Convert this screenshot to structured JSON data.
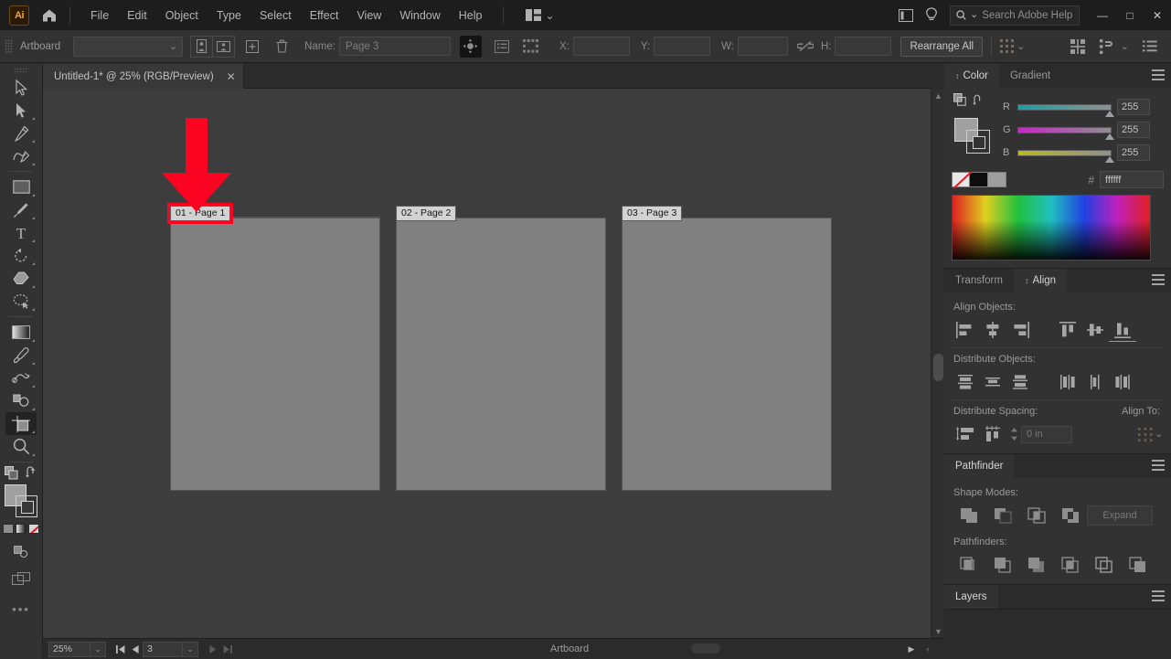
{
  "app": {
    "name": "Adobe Illustrator",
    "logo_text": "Ai",
    "logo_color": "#f2a33c"
  },
  "menubar": {
    "home_icon": "home-icon",
    "items": [
      "File",
      "Edit",
      "Object",
      "Type",
      "Select",
      "Effect",
      "View",
      "Window",
      "Help"
    ],
    "workspace_icon": "workspace-switcher-icon",
    "workspace_chevron": "⌄",
    "arrange_icon": "arrange-documents-icon",
    "help_bulb_icon": "lightbulb-icon",
    "search": {
      "placeholder": "Search Adobe Help",
      "icon": "search-icon",
      "chevron": "⌄"
    },
    "window_controls": {
      "minimize": "—",
      "maximize": "□",
      "close": "✕"
    }
  },
  "controlbar": {
    "context_label": "Artboard",
    "preset_select_chevron": "⌄",
    "portrait_icon": "artboard-portrait-icon",
    "landscape_icon": "artboard-landscape-icon",
    "new_artboard_icon": "new-artboard-icon",
    "delete_artboard_icon": "trash-icon",
    "name_label": "Name:",
    "name_value": "Page 3",
    "move_artwork_icon": "move-artwork-with-artboard-icon",
    "artboard_options_icon": "artboard-options-icon",
    "artboard_presets_icon": "artboard-presets-grid-icon",
    "x_label": "X:",
    "x_value": "",
    "y_label": "Y:",
    "y_value": "",
    "w_label": "W:",
    "w_value": "",
    "h_label": "H:",
    "h_value": "",
    "link_icon": "unlink-proportions-icon",
    "rearrange_label": "Rearrange All",
    "reference_point_icon": "reference-point-icon",
    "align_icon": "align-icon",
    "transform_icon": "transform-icon",
    "options_icon": "document-setup-list-icon"
  },
  "document": {
    "tab_title": "Untitled-1* @ 25% (RGB/Preview)",
    "close_icon": "✕",
    "overflow_chevron": "»"
  },
  "toolbar": {
    "tools": [
      {
        "name": "selection-tool",
        "active": false
      },
      {
        "name": "direct-selection-tool",
        "active": false
      },
      {
        "name": "pen-tool",
        "active": false
      },
      {
        "name": "curvature-tool",
        "active": false
      },
      {
        "name": "rectangle-tool",
        "active": false
      },
      {
        "name": "paintbrush-tool",
        "active": false
      },
      {
        "name": "type-tool",
        "active": false
      },
      {
        "name": "rotate-tool",
        "active": false
      },
      {
        "name": "eraser-tool",
        "active": false
      },
      {
        "name": "lasso-tool",
        "active": false
      },
      {
        "name": "gradient-tool",
        "active": false
      },
      {
        "name": "eyedropper-tool",
        "active": false
      },
      {
        "name": "blend-tool",
        "active": false
      },
      {
        "name": "shape-builder-tool",
        "active": false
      },
      {
        "name": "artboard-tool",
        "active": true
      },
      {
        "name": "zoom-tool",
        "active": false
      }
    ],
    "more_tools_icon": "•••"
  },
  "canvas": {
    "background": "#3d3d3d",
    "artboard_fill": "#808080",
    "artboards": [
      {
        "label": "01 - Page 1",
        "highlighted": true
      },
      {
        "label": "02 - Page 2",
        "highlighted": false
      },
      {
        "label": "03 - Page 3",
        "highlighted": false
      }
    ],
    "annotation": {
      "type": "red-arrow",
      "color": "#fb0422",
      "direction": "down",
      "points_to": "01 - Page 1"
    }
  },
  "statusbar": {
    "zoom_value": "25%",
    "zoom_chevron": "⌄",
    "first_icon": "◀|",
    "prev_icon": "◀",
    "artboard_number": "3",
    "number_chevron": "⌄",
    "next_icon": "▶",
    "last_icon": "|▶",
    "status_text": "Artboard",
    "status_play_icon": "▶",
    "status_left_icon": "‹"
  },
  "panels": {
    "color": {
      "tabs": [
        {
          "label": "Color",
          "active": true
        },
        {
          "label": "Gradient",
          "active": false
        }
      ],
      "menu_icon": "panel-menu-icon",
      "swap_icon": "swap-fill-stroke-icon",
      "fill_stroke_icon": "fill-stroke-proxy-icon",
      "sliders": [
        {
          "channel": "R",
          "value": "255",
          "gradient_from": "#18a0a8",
          "gradient_to": "#8f8f8f"
        },
        {
          "channel": "G",
          "value": "255",
          "gradient_from": "#c329c3",
          "gradient_to": "#8f8f8f"
        },
        {
          "channel": "B",
          "value": "255",
          "gradient_from": "#b8b81e",
          "gradient_to": "#8f8f8f"
        }
      ],
      "none_swatch": "none-swatch",
      "black_swatch": "#0d0d0d",
      "gray_swatch": "#9e9e9e",
      "hex_label": "#",
      "hex_value": "ffffff"
    },
    "align": {
      "tabs": [
        {
          "label": "Transform",
          "active": false
        },
        {
          "label": "Align",
          "active": true
        }
      ],
      "menu_icon": "panel-menu-icon",
      "align_objects_label": "Align Objects:",
      "align_objects_buttons": [
        "align-left-icon",
        "align-horizontal-center-icon",
        "align-right-icon",
        "align-top-icon",
        "align-vertical-center-icon",
        "align-bottom-icon"
      ],
      "distribute_objects_label": "Distribute Objects:",
      "distribute_objects_buttons": [
        "distribute-vertical-top-icon",
        "distribute-vertical-center-icon",
        "distribute-vertical-bottom-icon",
        "distribute-horizontal-left-icon",
        "distribute-horizontal-center-icon",
        "distribute-horizontal-right-icon"
      ],
      "distribute_spacing_label": "Distribute Spacing:",
      "distribute_spacing_buttons": [
        "distribute-vertical-space-icon",
        "distribute-horizontal-space-icon"
      ],
      "spacing_value": "0 in",
      "spacing_stepper_icon": "stepper-icon",
      "align_to_label": "Align To:",
      "align_to_icon": "align-to-selection-icon",
      "align_to_chevron": "⌄"
    },
    "pathfinder": {
      "tabs": [
        {
          "label": "Pathfinder",
          "active": true
        }
      ],
      "menu_icon": "panel-menu-icon",
      "shape_modes_label": "Shape Modes:",
      "shape_modes_buttons": [
        "unite-icon",
        "minus-front-icon",
        "intersect-icon",
        "exclude-icon"
      ],
      "expand_label": "Expand",
      "pathfinders_label": "Pathfinders:",
      "pathfinders_buttons": [
        "divide-icon",
        "trim-icon",
        "merge-icon",
        "crop-icon",
        "outline-icon",
        "minus-back-icon"
      ]
    },
    "layers": {
      "tabs": [
        {
          "label": "Layers",
          "active": true
        }
      ],
      "menu_icon": "panel-menu-icon"
    }
  }
}
